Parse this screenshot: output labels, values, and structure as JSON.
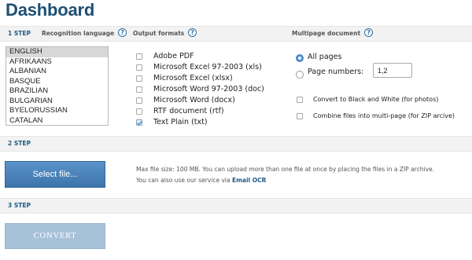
{
  "page": {
    "title": "Dashboard"
  },
  "step1": {
    "label": "1 STEP",
    "recognition_language_label": "Recognition language",
    "output_formats_label": "Output formats",
    "multipage_label": "Multipage document",
    "help_glyph": "?"
  },
  "languages": [
    "ENGLISH",
    "AFRIKAANS",
    "ALBANIAN",
    "BASQUE",
    "BRAZILIAN",
    "BULGARIAN",
    "BYELORUSSIAN",
    "CATALAN"
  ],
  "selected_language": "ENGLISH",
  "formats": [
    {
      "label": "Adobe PDF",
      "checked": false
    },
    {
      "label": "Microsoft Excel 97-2003 (xls)",
      "checked": false
    },
    {
      "label": "Microsoft Excel (xlsx)",
      "checked": false
    },
    {
      "label": "Microsoft Word 97-2003 (doc)",
      "checked": false
    },
    {
      "label": "Microsoft Word (docx)",
      "checked": false
    },
    {
      "label": "RTF document (rtf)",
      "checked": false
    },
    {
      "label": "Text Plain (txt)",
      "checked": true
    }
  ],
  "multipage": {
    "all_pages_label": "All pages",
    "page_numbers_label": "Page numbers:",
    "page_numbers_value": "1,2",
    "selected": "all_pages",
    "convert_bw_label": "Convert to Black and White (for photos)",
    "combine_label": "Combine files into multi-page (for ZIP arcive)"
  },
  "step2": {
    "label": "2 STEP",
    "select_button": "Select file...",
    "info_line1": "Max file size: 100 MB. You can upload more than one file at once by placing the files in a ZIP archive.",
    "info_line2_prefix": "You can also use our service via",
    "info_link": "Email OCR"
  },
  "step3": {
    "label": "3 STEP",
    "convert_button": "CONVERT"
  },
  "colors": {
    "title": "#1d4f73",
    "step_label": "#1e5a86",
    "select_button": "#4a84bb",
    "convert_button_disabled": "#a7c1d9"
  }
}
